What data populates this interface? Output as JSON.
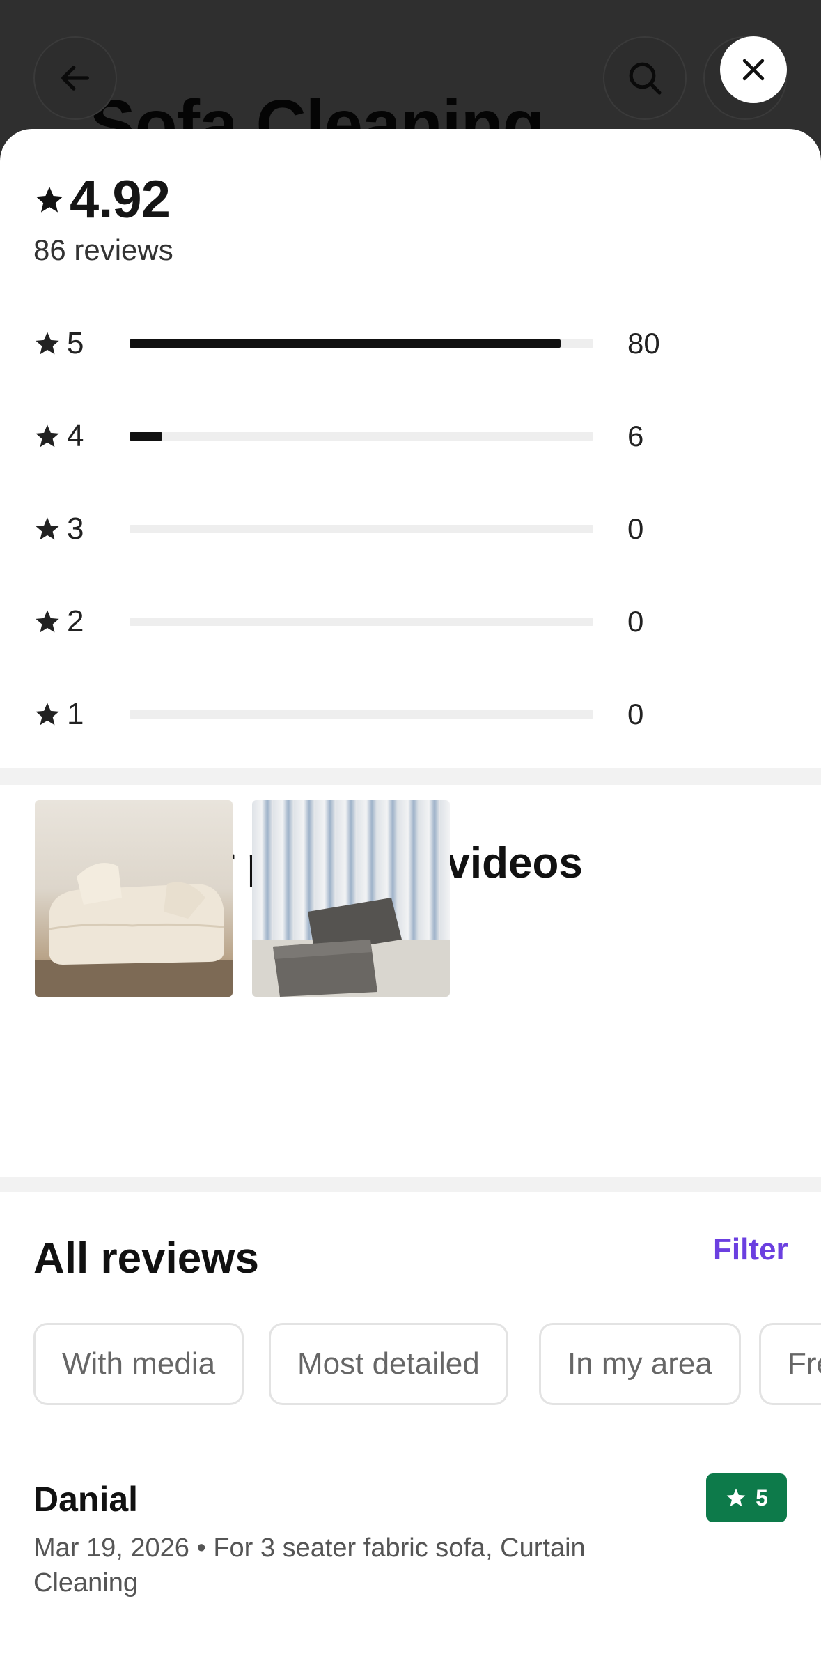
{
  "background": {
    "title": "Sofa Cleaning",
    "icons": [
      "back-arrow-icon",
      "search-icon"
    ]
  },
  "sheet": {
    "close_icon": "close-icon",
    "rating": "4.92",
    "review_count": "86 reviews",
    "distribution": [
      {
        "stars": "5",
        "count": "80",
        "fraction": 0.93
      },
      {
        "stars": "4",
        "count": "6",
        "fraction": 0.07
      },
      {
        "stars": "3",
        "count": "0",
        "fraction": 0
      },
      {
        "stars": "2",
        "count": "0",
        "fraction": 0
      },
      {
        "stars": "1",
        "count": "0",
        "fraction": 0
      }
    ],
    "media_title": "Customer photos & videos",
    "media_items": [
      "Cream three-seater sofa photo",
      "Grey sofa near curtains photo"
    ],
    "reviews_title": "All reviews",
    "filter_label": "Filter",
    "chips": [
      "With media",
      "Most detailed",
      "In my area",
      "Fre"
    ],
    "review": {
      "name": "Danial",
      "score": "5",
      "meta_line1": "Mar 19, 2026 • For 3 seater fabric sofa, Curtain",
      "meta_line2": "Cleaning"
    }
  },
  "colors": {
    "accent": "#6b3fe0",
    "badge_green": "#0d7a4a",
    "bar_fill": "#111111",
    "bar_track": "#eeeeee"
  }
}
